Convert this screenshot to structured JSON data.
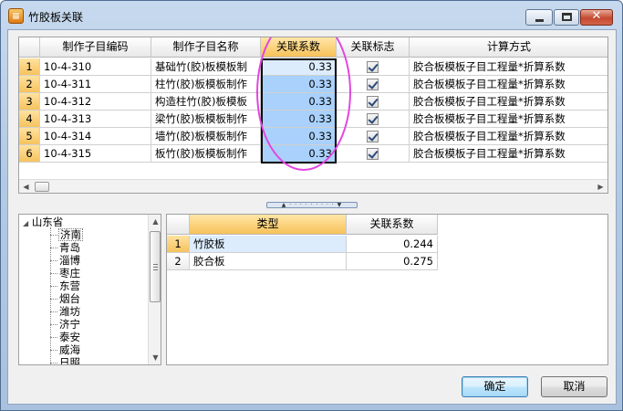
{
  "window": {
    "title": "竹胶板关联"
  },
  "top_grid": {
    "columns": [
      "制作子目编码",
      "制作子目名称",
      "关联系数",
      "关联标志",
      "计算方式"
    ],
    "rows": [
      {
        "no": "1",
        "code": "10-4-310",
        "name": "基础竹(胶)板模板制",
        "coef": "0.33",
        "flag": true,
        "method": "胶合板模板子目工程量*折算系数"
      },
      {
        "no": "2",
        "code": "10-4-311",
        "name": "柱竹(胶)板模板制作",
        "coef": "0.33",
        "flag": true,
        "method": "胶合板模板子目工程量*折算系数"
      },
      {
        "no": "3",
        "code": "10-4-312",
        "name": "构造柱竹(胶)板模板",
        "coef": "0.33",
        "flag": true,
        "method": "胶合板模板子目工程量*折算系数"
      },
      {
        "no": "4",
        "code": "10-4-313",
        "name": "梁竹(胶)板模板制作",
        "coef": "0.33",
        "flag": true,
        "method": "胶合板模板子目工程量*折算系数"
      },
      {
        "no": "5",
        "code": "10-4-314",
        "name": "墙竹(胶)板模板制作",
        "coef": "0.33",
        "flag": true,
        "method": "胶合板模板子目工程量*折算系数"
      },
      {
        "no": "6",
        "code": "10-4-315",
        "name": "板竹(胶)板模板制作",
        "coef": "0.33",
        "flag": true,
        "method": "胶合板模板子目工程量*折算系数"
      }
    ]
  },
  "tree": {
    "root": "山东省",
    "children": [
      "济南",
      "青岛",
      "淄博",
      "枣庄",
      "东营",
      "烟台",
      "潍坊",
      "济宁",
      "泰安",
      "威海",
      "日照"
    ],
    "selected": "济南"
  },
  "bottom_grid": {
    "columns": [
      "类型",
      "关联系数"
    ],
    "rows": [
      {
        "no": "1",
        "type": "竹胶板",
        "coef": "0.244"
      },
      {
        "no": "2",
        "type": "胶合板",
        "coef": "0.275"
      }
    ]
  },
  "buttons": {
    "ok": "确定",
    "cancel": "取消"
  },
  "colors": {
    "highlight_header": "#f7c259",
    "selected_cells": "#a9d1fb",
    "annotation_ellipse": "#e246e0"
  }
}
